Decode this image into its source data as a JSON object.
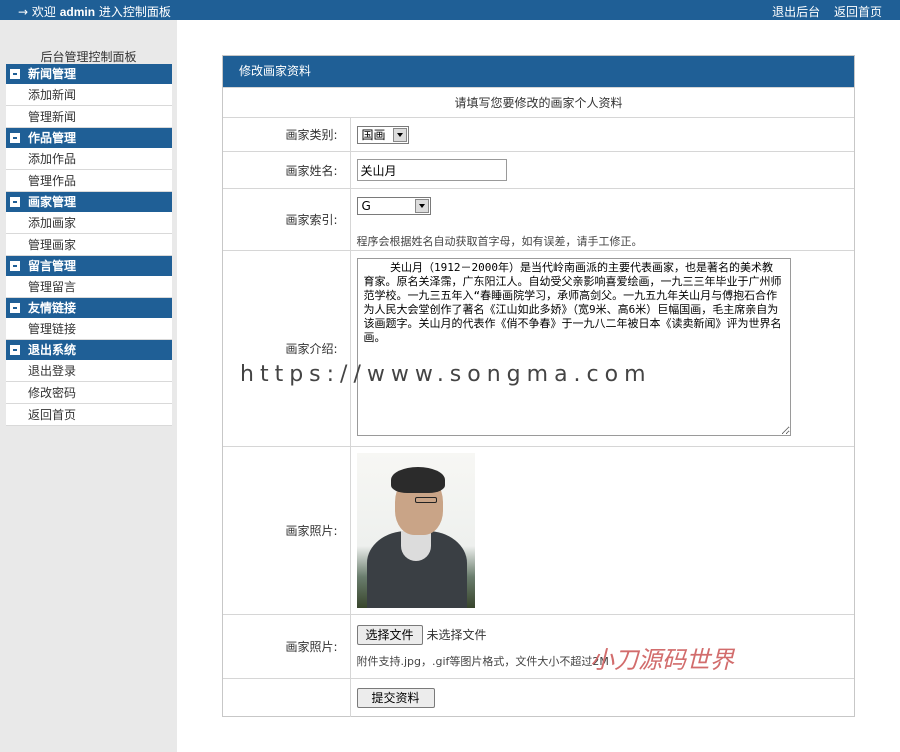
{
  "topbar": {
    "welcome_prefix": "→ 欢迎 ",
    "username": "admin",
    "welcome_suffix": " 进入控制面板",
    "logout_label": "退出后台",
    "home_label": "返回首页"
  },
  "sidebar": {
    "title": "后台管理控制面板",
    "groups": [
      {
        "title": "新闻管理",
        "items": [
          "添加新闻",
          "管理新闻"
        ]
      },
      {
        "title": "作品管理",
        "items": [
          "添加作品",
          "管理作品"
        ]
      },
      {
        "title": "画家管理",
        "items": [
          "添加画家",
          "管理画家"
        ]
      },
      {
        "title": "留言管理",
        "items": [
          "管理留言"
        ]
      },
      {
        "title": "友情链接",
        "items": [
          "管理链接"
        ]
      },
      {
        "title": "退出系统",
        "items": [
          "退出登录",
          "修改密码",
          "返回首页"
        ]
      }
    ]
  },
  "form": {
    "panel_title": "修改画家资料",
    "intro": "请填写您要修改的画家个人资料",
    "category_label": "画家类别:",
    "category_value": "国画",
    "name_label": "画家姓名:",
    "name_value": "关山月",
    "index_label": "画家索引:",
    "index_value": "G",
    "index_hint": "程序会根据姓名自动获取首字母，如有误差，请手工修正。",
    "bio_label": "画家介绍:",
    "bio_value": "    关山月（1912－2000年）是当代岭南画派的主要代表画家，也是著名的美术教育家。原名关泽霈，广东阳江人。自幼受父亲影响喜爱绘画，一九三三年毕业于广州师范学校。一九三五年入“春睡画院学习，承师高剑父。一九五九年关山月与傅抱石合作为人民大会堂创作了著名《江山如此多娇》（宽9米、高6米）巨幅国画，毛主席亲自为该画题字。关山月的代表作《俏不争春》于一九八二年被日本《读卖新闻》评为世界名画。",
    "photo_label": "画家照片:",
    "upload_label": "画家照片:",
    "choose_file_label": "选择文件",
    "no_file_text": "未选择文件",
    "upload_hint": "附件支持.jpg，.gif等图片格式，文件大小不超过2M",
    "submit_label": "提交资料"
  },
  "watermarks": {
    "url": "https://www.songma.com",
    "brand": "小刀源码世界"
  },
  "colors": {
    "brand_blue": "#1f5f96",
    "sidebar_bg": "#e9e9e9"
  }
}
